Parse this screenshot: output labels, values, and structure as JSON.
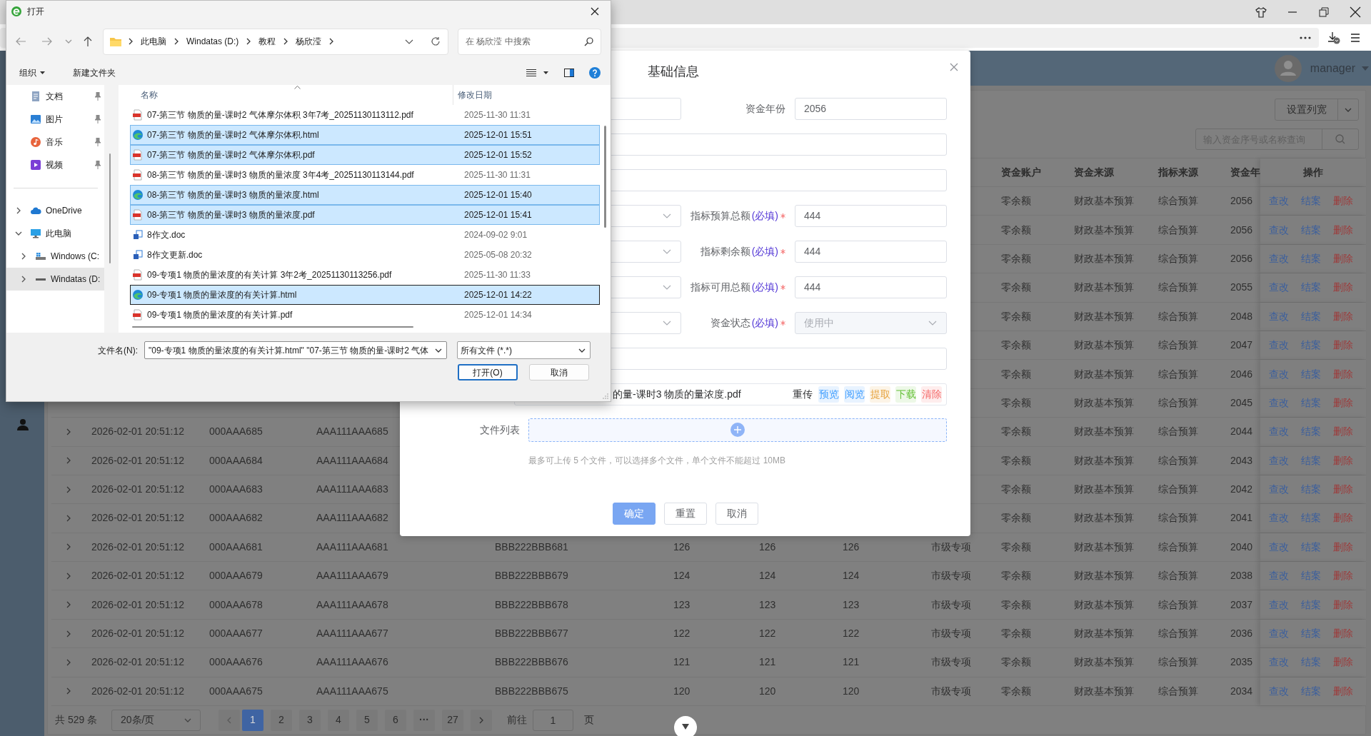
{
  "app": {
    "user": "manager"
  },
  "toolbar": {
    "column_width_button": "设置列宽",
    "search": {
      "placeholder": "输入资金序号或名称查询"
    }
  },
  "table": {
    "columns": [
      null,
      null,
      null,
      null,
      null,
      null,
      null,
      null,
      "资金账户",
      "资金来源",
      "指标来源",
      "资金年",
      "操作"
    ],
    "rows": [
      {
        "cells": [
          null,
          null,
          null,
          null,
          null,
          null,
          null,
          null,
          "零余额",
          "财政基本预算",
          "综合预算",
          "2056"
        ],
        "actions": [
          {
            "label": "查改",
            "kind": "edit"
          },
          {
            "label": "结案",
            "kind": "close"
          },
          {
            "label": "删除",
            "kind": "delete"
          }
        ]
      },
      {
        "cells": [
          null,
          null,
          null,
          null,
          null,
          null,
          null,
          null,
          "零余额",
          "财政基本预算",
          "综合预算",
          "2056"
        ],
        "actions": [
          {
            "label": "查改",
            "kind": "edit"
          },
          {
            "label": "结案",
            "kind": "close"
          },
          {
            "label": "删除",
            "kind": "delete"
          }
        ]
      },
      {
        "cells": [
          null,
          null,
          null,
          null,
          null,
          null,
          null,
          null,
          "零余额",
          "财政基本预算",
          "综合预算",
          "2056"
        ],
        "actions": [
          {
            "label": "查改",
            "kind": "edit"
          },
          {
            "label": "结案",
            "kind": "close"
          },
          {
            "label": "删除",
            "kind": "delete"
          }
        ]
      },
      {
        "cells": [
          null,
          null,
          null,
          null,
          null,
          null,
          null,
          null,
          "零余额",
          "财政基本预算",
          "综合预算",
          "2055"
        ],
        "actions": [
          {
            "label": "查改",
            "kind": "edit"
          },
          {
            "label": "结案",
            "kind": "close"
          },
          {
            "label": "删除",
            "kind": "delete"
          }
        ]
      },
      {
        "cells": [
          null,
          null,
          null,
          null,
          null,
          null,
          null,
          null,
          "零余额",
          "财政基本预算",
          "综合预算",
          "2048"
        ],
        "actions": [
          {
            "label": "查改",
            "kind": "edit"
          },
          {
            "label": "结案",
            "kind": "close"
          },
          {
            "label": "删除",
            "kind": "delete"
          }
        ]
      },
      {
        "cells": [
          null,
          null,
          null,
          null,
          null,
          null,
          null,
          null,
          "零余额",
          "财政基本预算",
          "综合预算",
          "2047"
        ],
        "actions": [
          {
            "label": "查改",
            "kind": "edit"
          },
          {
            "label": "结案",
            "kind": "close"
          },
          {
            "label": "删除",
            "kind": "delete"
          }
        ]
      },
      {
        "cells": [
          null,
          null,
          null,
          null,
          null,
          null,
          null,
          null,
          "零余额",
          "财政基本预算",
          "综合预算",
          "2046"
        ],
        "actions": [
          {
            "label": "查改",
            "kind": "edit"
          },
          {
            "label": "结案",
            "kind": "close"
          },
          {
            "label": "删除",
            "kind": "delete"
          }
        ]
      },
      {
        "cells": [
          null,
          null,
          null,
          null,
          null,
          null,
          null,
          null,
          "零余额",
          "财政基本预算",
          "综合预算",
          "2045"
        ],
        "actions": [
          {
            "label": "查改",
            "kind": "edit"
          },
          {
            "label": "结案",
            "kind": "close"
          },
          {
            "label": "删除",
            "kind": "delete"
          }
        ]
      },
      {
        "cells": [
          "2026-02-01 20:51:12",
          "000AAA685",
          "AAA111AAA685",
          null,
          null,
          null,
          null,
          null,
          "零余额",
          "财政基本预算",
          "综合预算",
          "2044"
        ],
        "actions": [
          {
            "label": "查改",
            "kind": "edit"
          },
          {
            "label": "结案",
            "kind": "close"
          },
          {
            "label": "删除",
            "kind": "delete"
          }
        ]
      },
      {
        "cells": [
          "2026-02-01 20:51:12",
          "000AAA684",
          "AAA111AAA684",
          null,
          null,
          null,
          null,
          null,
          "零余额",
          "财政基本预算",
          "综合预算",
          "2043"
        ],
        "actions": [
          {
            "label": "查改",
            "kind": "edit"
          },
          {
            "label": "结案",
            "kind": "close"
          },
          {
            "label": "删除",
            "kind": "delete"
          }
        ]
      },
      {
        "cells": [
          "2026-02-01 20:51:12",
          "000AAA683",
          "AAA111AAA683",
          null,
          null,
          null,
          null,
          null,
          "零余额",
          "财政基本预算",
          "综合预算",
          "2042"
        ],
        "actions": [
          {
            "label": "查改",
            "kind": "edit"
          },
          {
            "label": "结案",
            "kind": "close"
          },
          {
            "label": "删除",
            "kind": "delete"
          }
        ]
      },
      {
        "cells": [
          "2026-02-01 20:51:12",
          "000AAA682",
          "AAA111AAA682",
          null,
          null,
          null,
          null,
          null,
          "零余额",
          "财政基本预算",
          "综合预算",
          "2041"
        ],
        "actions": [
          {
            "label": "查改",
            "kind": "edit"
          },
          {
            "label": "结案",
            "kind": "close"
          },
          {
            "label": "删除",
            "kind": "delete"
          }
        ]
      },
      {
        "cells": [
          "2026-02-01 20:51:12",
          "000AAA681",
          "AAA111AAA681",
          "BBB222BBB681",
          "126",
          "126",
          "126",
          "市级专项",
          "零余额",
          "财政基本预算",
          "综合预算",
          "2040"
        ],
        "actions": [
          {
            "label": "查改",
            "kind": "edit"
          },
          {
            "label": "结案",
            "kind": "close"
          },
          {
            "label": "删除",
            "kind": "delete"
          }
        ]
      },
      {
        "cells": [
          "2026-02-01 20:51:12",
          "000AAA679",
          "AAA111AAA679",
          "BBB222BBB679",
          "124",
          "124",
          "124",
          "市级专项",
          "零余额",
          "财政基本预算",
          "综合预算",
          "2038"
        ],
        "actions": [
          {
            "label": "查改",
            "kind": "edit"
          },
          {
            "label": "结案",
            "kind": "close"
          },
          {
            "label": "删除",
            "kind": "delete"
          }
        ]
      },
      {
        "cells": [
          "2026-02-01 20:51:12",
          "000AAA678",
          "AAA111AAA678",
          "BBB222BBB678",
          "123",
          "123",
          "123",
          "市级专项",
          "零余额",
          "财政基本预算",
          "综合预算",
          "2037"
        ],
        "actions": [
          {
            "label": "查改",
            "kind": "edit"
          },
          {
            "label": "结案",
            "kind": "close"
          },
          {
            "label": "删除",
            "kind": "delete"
          }
        ]
      },
      {
        "cells": [
          "2026-02-01 20:51:12",
          "000AAA677",
          "AAA111AAA677",
          "BBB222BBB677",
          "122",
          "122",
          "122",
          "市级专项",
          "零余额",
          "财政基本预算",
          "综合预算",
          "2036"
        ],
        "actions": [
          {
            "label": "查改",
            "kind": "edit"
          },
          {
            "label": "结案",
            "kind": "close"
          },
          {
            "label": "删除",
            "kind": "delete"
          }
        ]
      },
      {
        "cells": [
          "2026-02-01 20:51:12",
          "000AAA676",
          "AAA111AAA676",
          "BBB222BBB676",
          "121",
          "121",
          "121",
          "市级专项",
          "零余额",
          "财政基本预算",
          "综合预算",
          "2035"
        ],
        "actions": [
          {
            "label": "查改",
            "kind": "edit"
          },
          {
            "label": "结案",
            "kind": "close"
          },
          {
            "label": "删除",
            "kind": "delete"
          }
        ]
      },
      {
        "cells": [
          "2026-02-01 20:51:12",
          "000AAA675",
          "AAA111AAA675",
          "BBB222BBB675",
          "120",
          "120",
          "120",
          "市级专项",
          "零余额",
          "财政基本预算",
          "综合预算",
          "2034"
        ],
        "actions": [
          {
            "label": "查改",
            "kind": "edit"
          },
          {
            "label": "结案",
            "kind": "close"
          },
          {
            "label": "删除",
            "kind": "delete"
          }
        ]
      }
    ]
  },
  "pagination": {
    "total": "共 529 条",
    "page_size": "20条/页",
    "pages": [
      {
        "label": "1",
        "selected": true,
        "kind": "page"
      },
      {
        "label": "2",
        "selected": false,
        "kind": "page"
      },
      {
        "label": "3",
        "selected": false,
        "kind": "page"
      },
      {
        "label": "4",
        "selected": false,
        "kind": "page"
      },
      {
        "label": "5",
        "selected": false,
        "kind": "page"
      },
      {
        "label": "6",
        "selected": false,
        "kind": "page"
      },
      {
        "label": "···",
        "selected": false,
        "kind": "more"
      },
      {
        "label": "27",
        "selected": false,
        "kind": "page"
      }
    ],
    "goto": "前往",
    "goto_value": "1",
    "page_unit": "页"
  },
  "form": {
    "title": "基础信息",
    "rows": [
      {
        "kind": "pair",
        "left": {
          "kind": "input"
        },
        "right": {
          "label": "资金年份",
          "required": false,
          "kind": "input",
          "value": "2056",
          "disabled": false
        }
      },
      {
        "kind": "wide"
      },
      {
        "kind": "wide"
      },
      {
        "kind": "pair",
        "left": {
          "kind": "select"
        },
        "right": {
          "label": "指标预算总额",
          "note": "(必填)",
          "required": true,
          "kind": "input",
          "value": "444",
          "disabled": false
        }
      },
      {
        "kind": "pair",
        "left": {
          "kind": "select"
        },
        "right": {
          "label": "指标剩余额",
          "note": "(必填)",
          "required": true,
          "kind": "input",
          "value": "444",
          "disabled": false
        }
      },
      {
        "kind": "pair",
        "left": {
          "kind": "select"
        },
        "right": {
          "label": "指标可用总额",
          "note": "(必填)",
          "required": true,
          "kind": "input",
          "value": "444",
          "disabled": false
        }
      },
      {
        "kind": "pair",
        "left": {
          "kind": "select"
        },
        "right": {
          "label": "资金状态",
          "note": "(必填)",
          "required": true,
          "kind": "select",
          "value": "使用中",
          "disabled": true
        }
      },
      {
        "kind": "wide"
      },
      {
        "kind": "file",
        "name": "的量-课时3 物质的量浓度.pdf",
        "reupload": "重传",
        "tags": [
          {
            "label": "预览",
            "color": "#409eff"
          },
          {
            "label": "阅览",
            "color": "#409eff"
          },
          {
            "label": "提取",
            "color": "#e6a23c"
          },
          {
            "label": "下载",
            "color": "#67c23a"
          },
          {
            "label": "清除",
            "color": "#f56c6c"
          }
        ]
      },
      {
        "kind": "upload",
        "label": "文件列表"
      }
    ],
    "hint": "最多可上传 5 个文件，可以选择多个文件，单个文件不能超过 10MB",
    "buttons": [
      {
        "label": "确定",
        "kind": "primary"
      },
      {
        "label": "重置",
        "kind": "default"
      },
      {
        "label": "取消",
        "kind": "default"
      }
    ]
  },
  "dialog": {
    "title": "打开",
    "path": [
      "此电脑",
      "Windatas (D:)",
      "教程",
      "杨欣滢"
    ],
    "search": {
      "placeholder": "在 杨欣滢 中搜索"
    },
    "organize": "组织",
    "new_folder": "新建文件夹",
    "nav": [
      {
        "label": "文档",
        "kind": "documents",
        "pinned": true,
        "selected": false
      },
      {
        "label": "图片",
        "kind": "pictures",
        "pinned": true,
        "selected": false
      },
      {
        "label": "音乐",
        "kind": "music",
        "pinned": true,
        "selected": false
      },
      {
        "label": "视频",
        "kind": "videos",
        "pinned": true,
        "selected": false
      },
      {
        "label": "OneDrive",
        "kind": "cloud",
        "expanded": false,
        "selected": false
      },
      {
        "label": "此电脑",
        "kind": "computer",
        "expanded": true,
        "selected": false,
        "children": [
          {
            "label": "Windows (C:",
            "kind": "system-drive",
            "expanded": false,
            "selected": false
          },
          {
            "label": "Windatas (D:",
            "kind": "drive",
            "expanded": false,
            "selected": true
          }
        ]
      }
    ],
    "columns": [
      "名称",
      "修改日期"
    ],
    "files": [
      {
        "name": "07-第三节 物质的量-课时2 气体摩尔体积 3年7考_20251130113112.pdf",
        "date": "2025-11-30 11:31",
        "kind": "pdf",
        "selected": false,
        "focused": false
      },
      {
        "name": "07-第三节 物质的量-课时2 气体摩尔体积.html",
        "date": "2025-12-01 15:51",
        "kind": "html",
        "selected": true,
        "focused": false
      },
      {
        "name": "07-第三节 物质的量-课时2 气体摩尔体积.pdf",
        "date": "2025-12-01 15:52",
        "kind": "pdf",
        "selected": true,
        "focused": false
      },
      {
        "name": "08-第三节 物质的量-课时3 物质的量浓度 3年4考_20251130113144.pdf",
        "date": "2025-11-30 11:31",
        "kind": "pdf",
        "selected": false,
        "focused": false
      },
      {
        "name": "08-第三节 物质的量-课时3 物质的量浓度.html",
        "date": "2025-12-01 15:40",
        "kind": "html",
        "selected": true,
        "focused": false
      },
      {
        "name": "08-第三节 物质的量-课时3 物质的量浓度.pdf",
        "date": "2025-12-01 15:41",
        "kind": "pdf",
        "selected": true,
        "focused": false
      },
      {
        "name": "8作文.doc",
        "date": "2024-09-02 9:01",
        "kind": "doc",
        "selected": false,
        "focused": false
      },
      {
        "name": "8作文更新.doc",
        "date": "2025-05-08 20:32",
        "kind": "doc",
        "selected": false,
        "focused": false
      },
      {
        "name": "09-专项1 物质的量浓度的有关计算 3年2考_20251130113256.pdf",
        "date": "2025-11-30 11:33",
        "kind": "pdf",
        "selected": false,
        "focused": false
      },
      {
        "name": "09-专项1 物质的量浓度的有关计算.html",
        "date": "2025-12-01 14:22",
        "kind": "html",
        "selected": true,
        "focused": true
      },
      {
        "name": "09-专项1 物质的量浓度的有关计算.pdf",
        "date": "2025-12-01 14:34",
        "kind": "pdf",
        "selected": false,
        "focused": false
      }
    ],
    "filename_label": "文件名(N):",
    "filename": "\"09-专项1 物质的量浓度的有关计算.html\" \"07-第三节 物质的量-课时2 气体",
    "filetype": "所有文件 (*.*)",
    "buttons": [
      {
        "label": "打开(O)",
        "kind": "primary"
      },
      {
        "label": "取消",
        "kind": "default"
      }
    ]
  }
}
